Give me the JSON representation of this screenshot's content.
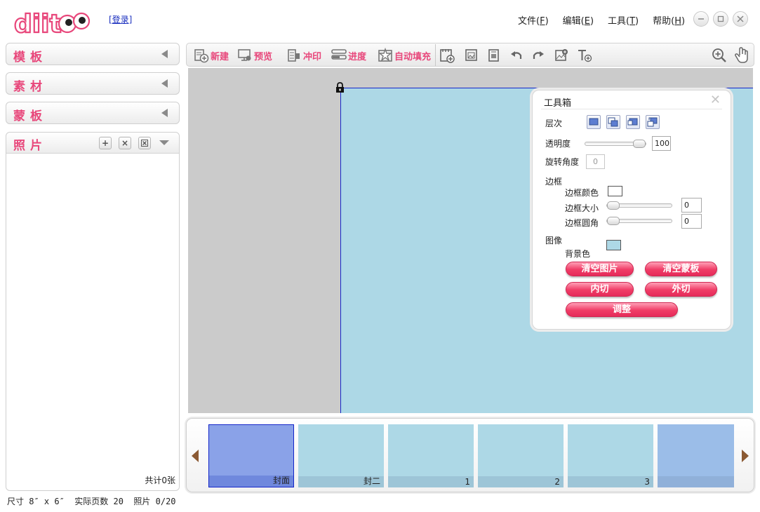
{
  "app": {
    "logo_text": "diitoo",
    "login_link": "[登录]"
  },
  "menu": [
    {
      "label": "文件(",
      "key": "F",
      "suffix": ")"
    },
    {
      "label": "编辑(",
      "key": "E",
      "suffix": ")"
    },
    {
      "label": "工具(",
      "key": "T",
      "suffix": ")"
    },
    {
      "label": "帮助(",
      "key": "H",
      "suffix": ")"
    }
  ],
  "window_controls": [
    "minimize-icon",
    "maximize-icon",
    "close-icon"
  ],
  "sidebar": {
    "sections": [
      {
        "label": "模板",
        "icon": "collapse-arrow-icon"
      },
      {
        "label": "素材",
        "icon": "collapse-arrow-icon"
      },
      {
        "label": "蒙板",
        "icon": "collapse-arrow-icon"
      }
    ],
    "photo_panel": {
      "label": "照片",
      "buttons": [
        "add-photo-icon",
        "remove-photo-icon",
        "clear-photos-icon"
      ],
      "count_text": "共计0张"
    }
  },
  "status_bar": {
    "size_text": "尺寸 8″ x 6″",
    "pages_text": "实际页数 20",
    "photos_text": "照片 0/20"
  },
  "toolbar": {
    "new_label": "新建",
    "preview_label": "预览",
    "print_label": "冲印",
    "progress_label": "进度",
    "autofill_label": "自动填充",
    "icons": [
      "add-page-icon",
      "insert-photo-icon",
      "insert-image-frame-icon",
      "undo-icon",
      "redo-icon",
      "add-picture-icon",
      "add-text-icon",
      "zoom-in-icon",
      "hand-pan-icon"
    ]
  },
  "canvas": {
    "page_color": "#add8e6",
    "lock_icon": "lock-icon"
  },
  "toolbox": {
    "title": "工具箱",
    "layer_label": "层次",
    "opacity_label": "透明度",
    "opacity_value": "100",
    "opacity_level": 1.0,
    "rotation_label": "旋转角度",
    "rotation_value": "0",
    "border_label": "边框",
    "border_color_label": "边框颜色",
    "border_size_label": "边框大小",
    "border_size_value": "0",
    "border_radius_label": "边框圆角",
    "border_radius_value": "0",
    "image_label": "图像",
    "bg_color_label": "背景色",
    "bg_color": "#add8e6",
    "clear_photo_label": "清空图片",
    "clear_mask_label": "清空蒙板",
    "inner_cut_label": "内切",
    "outer_cut_label": "外切",
    "adjust_label": "调整"
  },
  "filmstrip": {
    "pages": [
      {
        "label": "封面",
        "selected": true
      },
      {
        "label": "封二",
        "selected": false
      },
      {
        "label": "1",
        "selected": false
      },
      {
        "label": "2",
        "selected": false
      },
      {
        "label": "3",
        "selected": false
      },
      {
        "label": "",
        "selected": false
      }
    ]
  },
  "colors": {
    "accent_pink": "#e8477b",
    "selection_blue": "#1526c9"
  }
}
